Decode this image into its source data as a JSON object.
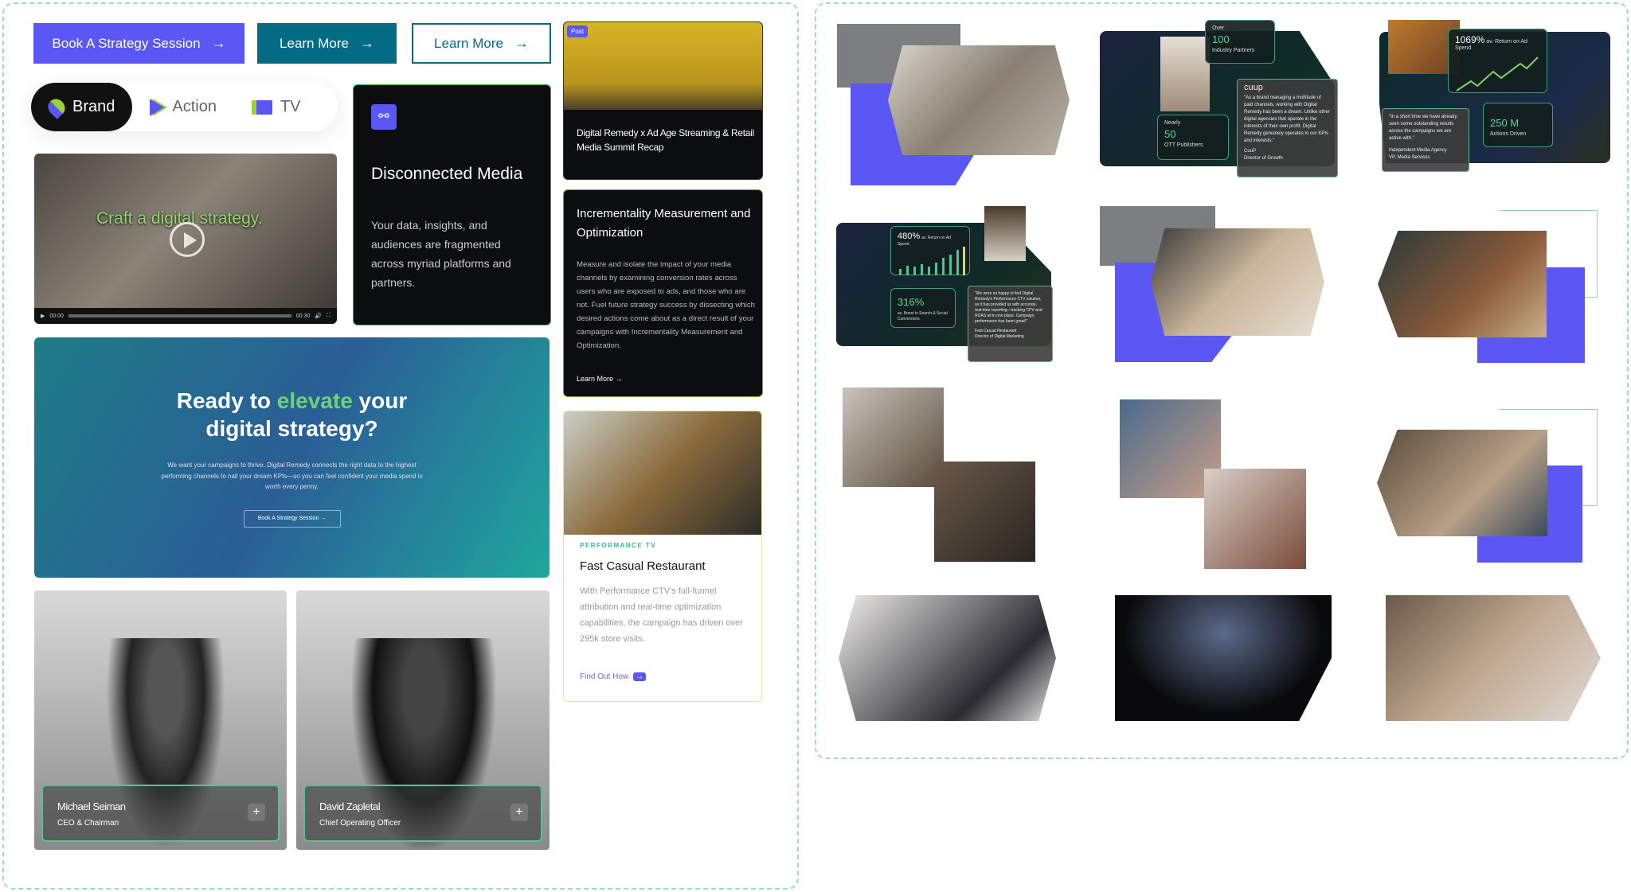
{
  "buttons": {
    "book": "Book A Strategy Session",
    "learn_more_filled": "Learn More",
    "learn_more_outline": "Learn More",
    "arrow": "→"
  },
  "tabs": [
    {
      "label": "Brand",
      "icon": "location-pin-icon"
    },
    {
      "label": "Action",
      "icon": "play-chevron-icon"
    },
    {
      "label": "TV",
      "icon": "monitor-icon"
    }
  ],
  "video": {
    "caption": "Craft a digital strategy.",
    "time_current": "00:00",
    "time_total": "00:30"
  },
  "disconnected": {
    "title": "Disconnected Media",
    "body": "Your data, insights, and audiences are fragmented across myriad platforms and partners.",
    "icon": "broken-link-icon"
  },
  "post": {
    "badge": "Post",
    "title": "Digital Remedy x Ad Age Streaming & Retail Media Summit Recap"
  },
  "incrementality": {
    "title": "Incrementality Measurement and Optimization",
    "body": "Measure and isolate the impact of your media channels by examining conversion rates across users who are exposed to ads, and those who are not. Fuel future strategy success by dissecting which desired actions come about as a direct result of your campaigns with Incrementality Measurement and Optimization.",
    "link": "Learn More"
  },
  "cta": {
    "title_pre": "Ready to ",
    "title_highlight": "elevate",
    "title_post": " your digital strategy?",
    "body": "We want your campaigns to thrive. Digital Remedy connects the right data to the highest performing channels to nail your dream KPIs—so you can feel confident your media spend is worth every penny.",
    "button": "Book A Strategy Session"
  },
  "case": {
    "eyebrow": "PERFORMANCE TV",
    "title": "Fast Casual Restaurant",
    "body": "With Performance CTV's full-funnel attribution and real-time optimization capabilities, the campaign has driven over 295k store visits.",
    "link": "Find Out How"
  },
  "people": [
    {
      "name": "Michael Seiman",
      "role": "CEO & Chairman"
    },
    {
      "name": "David Zapletal",
      "role": "Chief Operating Officer"
    }
  ],
  "tiles": {
    "cuup": {
      "over": "Over",
      "partners_value": "100",
      "partners_label": "Industry Partners",
      "nearly": "Nearly",
      "pubs_value": "50",
      "pubs_label": "OTT Publishers",
      "logo": "cuup",
      "quote": "\"As a brand managing a multitude of paid channels, working with Digital Remedy has been a dream. Unlike other digital agencies that operate in the interests of their own profit, Digital Remedy genuinely operates to our KPIs and interests.\"",
      "author": "CuuP",
      "author_role": "Director of Growth"
    },
    "agency": {
      "roas_value": "1069%",
      "roas_label": "av. Return on Ad Spend",
      "actions_value": "250 M",
      "actions_label": "Actions Driven",
      "quote": "\"In a short time we have already seen some outstanding results across the campaigns we are active with.\"",
      "author": "Independent Media Agency",
      "author_role": "VP, Media Services"
    },
    "restaurant": {
      "roas_value": "480%",
      "roas_label": "av. Return on Ad Spend",
      "boost_value": "316%",
      "boost_label": "av. Boost in Search & Social Conversions",
      "quote": "\"We were so happy to find Digital Remedy's Performance CTV solution, as it has provided us with accurate, real-time reporting—tracking CPV and ROAS all in one place. Campaign performance has been great!\"",
      "author": "Fast Casual Restaurant",
      "author_role": "Director of Digital Marketing"
    }
  },
  "colors": {
    "primary": "#5b57f5",
    "teal": "#036b84",
    "green": "#5fd3a0",
    "dark": "#0b0d0e"
  }
}
